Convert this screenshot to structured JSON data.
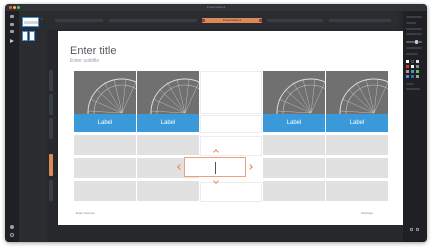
{
  "window": {
    "title": "Presentation1"
  },
  "topbar": {
    "active_tab_label": "Presentation1"
  },
  "slides": [
    {
      "number": "1"
    }
  ],
  "canvas": {
    "title": "Enter title",
    "subtitle": "Enter subtitle",
    "footer_left": "Enter footnote",
    "footer_right": "Add logo"
  },
  "cards": [
    {
      "label": "Label"
    },
    {
      "label": "Label"
    },
    {
      "label": ""
    },
    {
      "label": "Label"
    },
    {
      "label": "Label"
    }
  ],
  "colors": {
    "accent_blue": "#3a9ad9",
    "accent_orange": "#d9895a",
    "chrome_dark": "#26282c"
  },
  "icons": [
    "play-icon",
    "user-icon",
    "settings-icon",
    "chevron-up-icon",
    "chevron-down-icon",
    "chevron-left-icon",
    "chevron-right-icon"
  ]
}
